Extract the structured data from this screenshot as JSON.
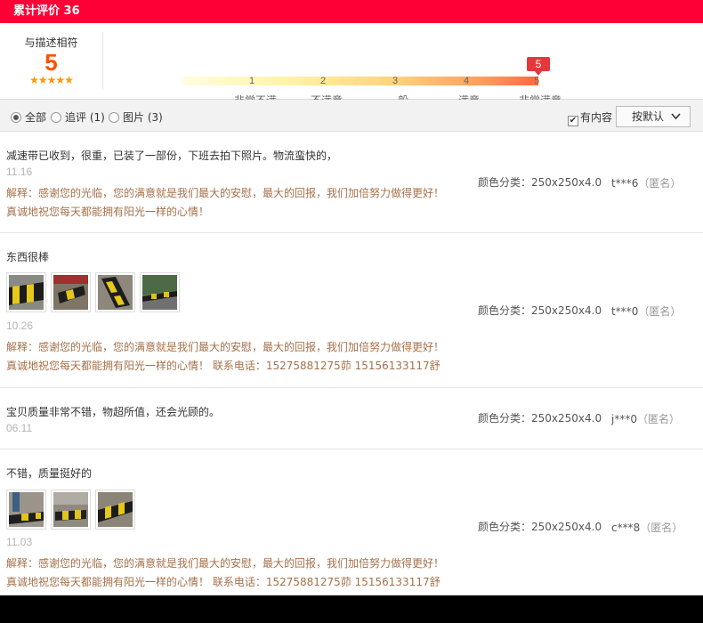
{
  "header": {
    "title": "累计评价 36"
  },
  "summary": {
    "label": "与描述相符",
    "score": "5",
    "stars": "★★★★★",
    "marker": "5",
    "scale": [
      {
        "num": "1",
        "label": "非常不满"
      },
      {
        "num": "2",
        "label": "不满意"
      },
      {
        "num": "3",
        "label": "一般"
      },
      {
        "num": "4",
        "label": "满意"
      },
      {
        "num": "5",
        "label": "非常满意"
      }
    ]
  },
  "filter": {
    "options": [
      {
        "label": "全部",
        "selected": true
      },
      {
        "label": "追评 (1)",
        "selected": false
      },
      {
        "label": "图片 (3)",
        "selected": false
      }
    ],
    "has_content_label": "有内容",
    "has_content_checked": true,
    "sort_label": "按默认"
  },
  "reviews": [
    {
      "content": "减速带已收到，很重，已装了一部份，下班去拍下照片。物流蛮快的，",
      "date": "11.16",
      "reply_line1": "解释：感谢您的光临，您的满意就是我们最大的安慰，最大的回报，我们加倍努力做得更好！",
      "reply_line2": "真诚地祝您每天都能拥有阳光一样的心情！",
      "sku": "颜色分类：250x250x4.0",
      "user": "t***6",
      "anon": "（匿名）",
      "images": []
    },
    {
      "content": "东西很棒",
      "date": "10.26",
      "reply_line1": "解释：感谢您的光临，您的满意就是我们最大的安慰，最大的回报，我们加倍努力做得更好！",
      "reply_line2": "真诚地祝您每天都能拥有阳光一样的心情！ 联系电话：15275881275茆 15156133117舒",
      "sku": "颜色分类：250x250x4.0",
      "user": "t***0",
      "anon": "（匿名）",
      "images": [
        "photo-1",
        "photo-2",
        "photo-3",
        "photo-4"
      ]
    },
    {
      "content": "宝贝质量非常不错，物超所值，还会光顾的。",
      "date": "06.11",
      "reply_line1": "",
      "reply_line2": "",
      "sku": "颜色分类：250x250x4.0",
      "user": "j***0",
      "anon": "（匿名）",
      "images": []
    },
    {
      "content": "不错，质量挺好的",
      "date": "11.03",
      "reply_line1": "解释：感谢您的光临，您的满意就是我们最大的安慰，最大的回报，我们加倍努力做得更好！",
      "reply_line2": "真诚地祝您每天都能拥有阳光一样的心情！ 联系电话：15275881275茆 15156133117舒",
      "sku": "颜色分类：250x250x4.0",
      "user": "c***8",
      "anon": "（匿名）",
      "images": [
        "photo-5",
        "photo-6",
        "photo-7"
      ]
    }
  ]
}
